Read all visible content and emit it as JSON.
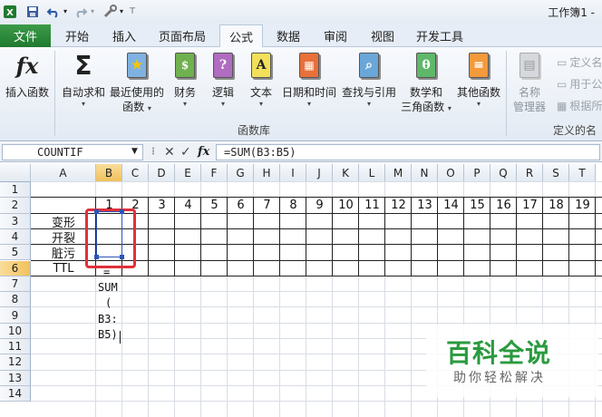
{
  "window": {
    "title": "工作簿1 -"
  },
  "quick_access": {
    "icons": [
      "excel-logo-icon",
      "save-icon",
      "undo-icon",
      "redo-icon",
      "tools-icon",
      "customize-icon"
    ]
  },
  "tabs": {
    "file": "文件",
    "items": [
      "开始",
      "插入",
      "页面布局",
      "公式",
      "数据",
      "审阅",
      "视图",
      "开发工具"
    ],
    "active": "公式"
  },
  "ribbon": {
    "insert_function": "插入函数",
    "autosum": "自动求和",
    "recent": [
      "最近使用的",
      "函数"
    ],
    "financial": "财务",
    "logical": "逻辑",
    "text": "文本",
    "datetime": "日期和时间",
    "lookup": "查找与引用",
    "math": [
      "数学和",
      "三角函数"
    ],
    "more": "其他函数",
    "group_label": "函数库",
    "name_manager": [
      "名称",
      "管理器"
    ],
    "define_name": "定义名",
    "use_in_formula": "用于公",
    "create_from_selection": "根据所",
    "group_label2": "定义的名"
  },
  "formula_bar": {
    "name_box": "COUNTIF",
    "formula": "=SUM(B3:B5)",
    "fx": "fx"
  },
  "columns": [
    "A",
    "B",
    "C",
    "D",
    "E",
    "F",
    "G",
    "H",
    "I",
    "J",
    "K",
    "L",
    "M",
    "N",
    "O",
    "P",
    "Q",
    "R",
    "S",
    "T"
  ],
  "rows": [
    "1",
    "2",
    "3",
    "4",
    "5",
    "6",
    "7",
    "8",
    "9",
    "10",
    "11",
    "12",
    "13",
    "14"
  ],
  "selected_column": "B",
  "selected_row": "6",
  "header_numbers": [
    "1",
    "2",
    "3",
    "4",
    "5",
    "6",
    "7",
    "8",
    "9",
    "10",
    "11",
    "12",
    "13",
    "14",
    "15",
    "16",
    "17",
    "18",
    "19"
  ],
  "row_labels": [
    "变形",
    "开裂",
    "脏污",
    "TTL"
  ],
  "edit_text": {
    "eq": "=",
    "l1": "SUM",
    "l2": "(",
    "l3": "B3:",
    "l4": "B5)"
  },
  "watermark": {
    "title": "百科全说",
    "subtitle": "助你轻松解决"
  }
}
